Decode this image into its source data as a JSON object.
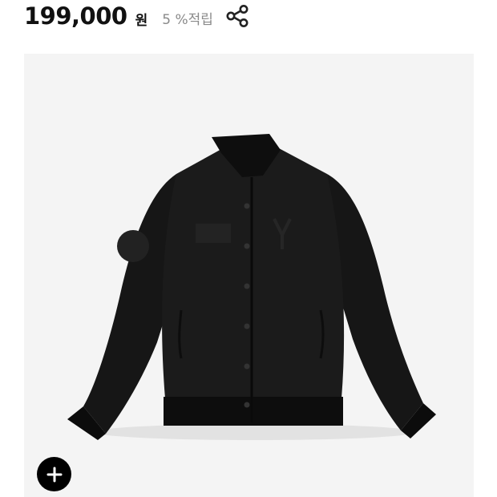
{
  "product": {
    "price": "199,000",
    "currency_unit": "원",
    "points_label": "5 %적립",
    "image_alt": "",
    "colors": {
      "frame_background": "#f4f4f4",
      "jacket": "#151515",
      "price_text": "#111111",
      "points_text": "#8a8a8a"
    }
  },
  "icons": {
    "share": "share-icon",
    "expand": "plus-icon"
  }
}
